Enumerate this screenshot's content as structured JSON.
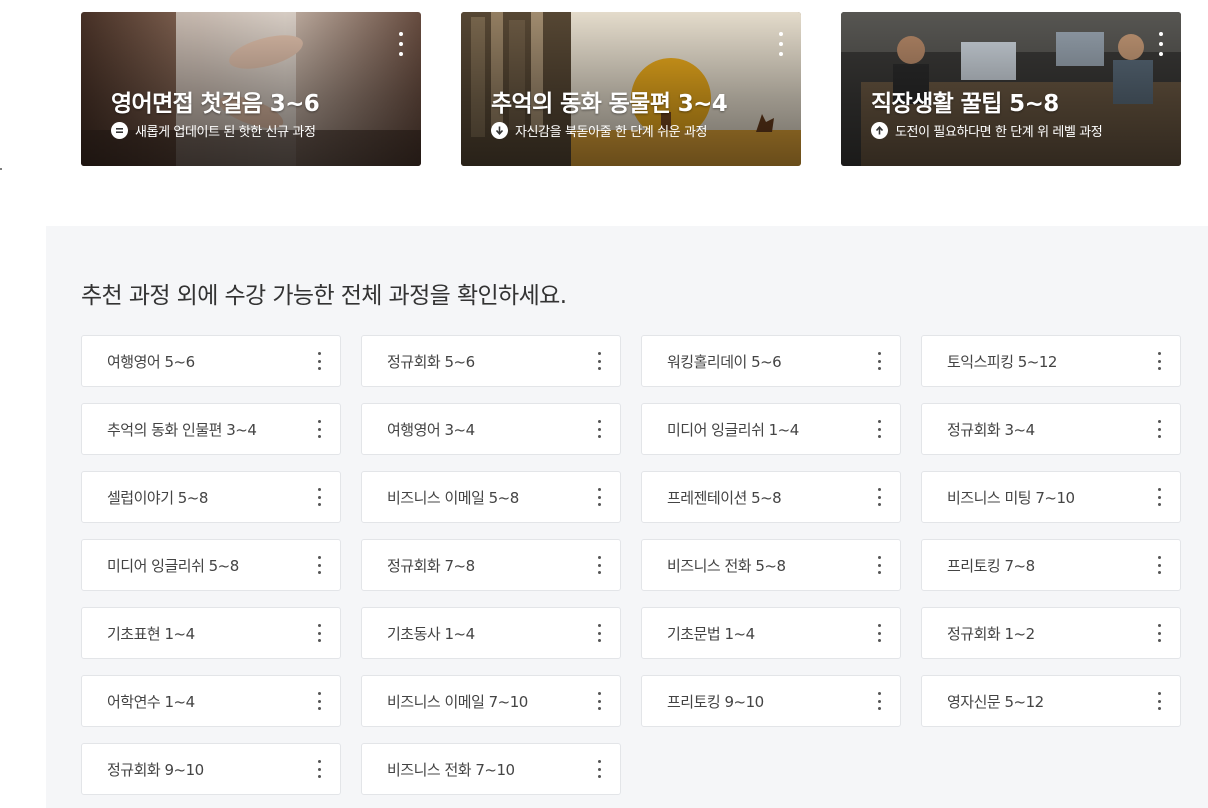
{
  "featured": [
    {
      "title": "영어면접 첫걸음 3~6",
      "subtitle": "새롭게 업데이트 된 핫한 신규 과정",
      "badge_icon": "equals-circle-icon",
      "image_icon": "interview-hands-photo"
    },
    {
      "title": "추억의 동화 동물편 3~4",
      "subtitle": "자신감을 북돋아줄 한 단계 쉬운 과정",
      "badge_icon": "arrow-down-circle-icon",
      "image_icon": "storybook-deer-photo"
    },
    {
      "title": "직장생활 꿀팁 5~8",
      "subtitle": "도전이 필요하다면 한 단계 위 레벨 과정",
      "badge_icon": "arrow-up-circle-icon",
      "image_icon": "office-workers-photo"
    }
  ],
  "all_courses": {
    "heading": "추천 과정 외에 수강 가능한 전체 과정을 확인하세요.",
    "items": [
      "여행영어 5~6",
      "정규회화 5~6",
      "워킹홀리데이 5~6",
      "토익스피킹 5~12",
      "추억의 동화 인물편 3~4",
      "여행영어 3~4",
      "미디어 잉글리쉬 1~4",
      "정규회화 3~4",
      "셀럽이야기 5~8",
      "비즈니스 이메일 5~8",
      "프레젠테이션 5~8",
      "비즈니스 미팅 7~10",
      "미디어 잉글리쉬 5~8",
      "정규회화 7~8",
      "비즈니스 전화 5~8",
      "프리토킹 7~8",
      "기초표현 1~4",
      "기초동사 1~4",
      "기초문법 1~4",
      "정규회화 1~2",
      "어학연수 1~4",
      "비즈니스 이메일 7~10",
      "프리토킹 9~10",
      "영자신문 5~12",
      "정규회화 9~10",
      "비즈니스 전화 7~10"
    ]
  },
  "colors": {
    "section_bg": "#f5f6f8",
    "card_border": "#e3e5e8",
    "text_dark": "#333333"
  }
}
